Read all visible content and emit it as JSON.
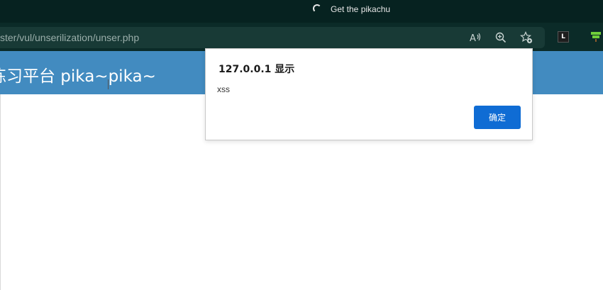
{
  "browser": {
    "tab_title": "Get the pikachu",
    "tab_state_icon": "loading-spinner-icon",
    "address_url": "ster/vul/unserilization/unser.php",
    "icons": [
      "read-aloud-icon",
      "zoom-icon",
      "add-favorite-icon"
    ],
    "extensions": [
      {
        "name": "extension-l-icon",
        "label": "L"
      },
      {
        "name": "extension-tree-icon"
      }
    ],
    "colors": {
      "titlebar": "#062220",
      "toolbar": "#0b2b28",
      "addressbar": "#183a36"
    }
  },
  "page": {
    "header_title": "练习平台 pika~pika~",
    "header_color": "#428bc0"
  },
  "dialog": {
    "title": "127.0.0.1 显示",
    "message": "xss",
    "ok_label": "确定",
    "button_color": "#0f6cd4"
  }
}
